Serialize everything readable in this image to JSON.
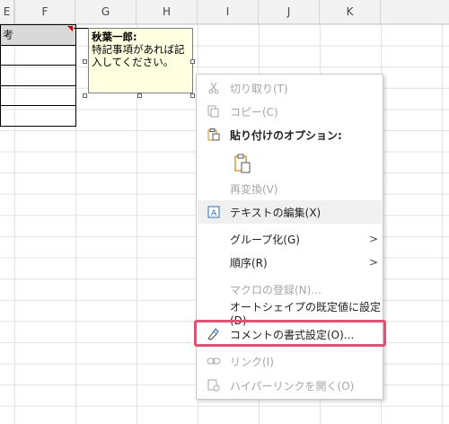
{
  "columns": [
    "E",
    "F",
    "G",
    "H",
    "I",
    "J",
    "K"
  ],
  "cell": {
    "header_text": "考"
  },
  "comment": {
    "author": "秋葉一郎:",
    "text": "特記事項があれば記入してください。"
  },
  "menu": {
    "cut": "切り取り(T)",
    "copy": "コピー(C)",
    "paste_options": "貼り付けのオプション:",
    "reconvert": "再変換(V)",
    "edit_text": "テキストの編集(X)",
    "group": "グループ化(G)",
    "order": "順序(R)",
    "assign_macro": "マクロの登録(N)...",
    "set_default": "オートシェイプの既定値に設定(D)",
    "format_comment": "コメントの書式設定(O)...",
    "link": "リンク(I)",
    "open_hyperlink": "ハイパーリンクを開く(O)",
    "submenu_arrow": ">"
  },
  "colors": {
    "highlight": "#e05273",
    "comment_bg": "#ffffe1",
    "accent_orange": "#d68a1e"
  }
}
